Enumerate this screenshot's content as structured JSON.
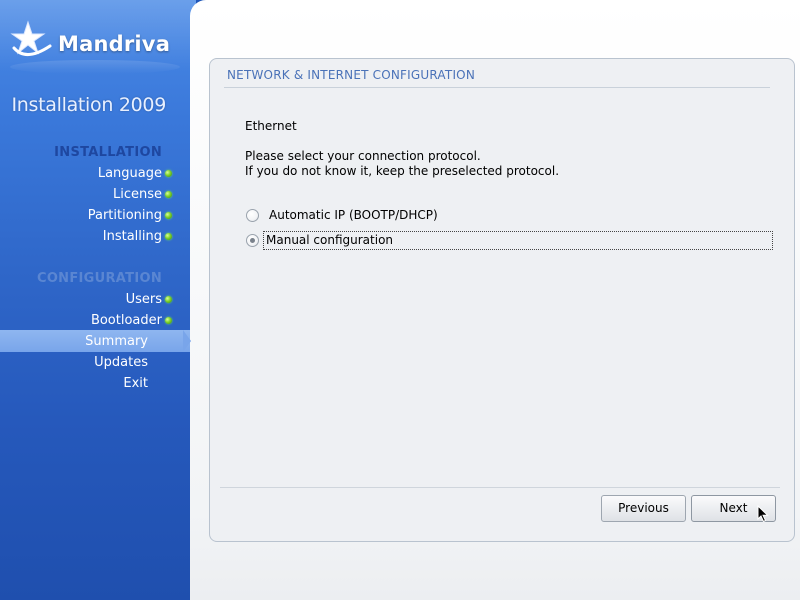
{
  "brand": {
    "name": "Mandriva",
    "product": "Installation 2009"
  },
  "sidebar": {
    "installation_title": "INSTALLATION",
    "installation_steps": [
      "Language",
      "License",
      "Partitioning",
      "Installing"
    ],
    "configuration_title": "CONFIGURATION",
    "configuration_steps": [
      "Users",
      "Bootloader"
    ],
    "current_step": "Summary",
    "other_steps": [
      "Updates",
      "Exit"
    ]
  },
  "panel": {
    "title": "NETWORK & INTERNET CONFIGURATION",
    "subtitle": "Ethernet",
    "prompt_line1": "Please select your connection protocol.",
    "prompt_line2": "If you do not know it, keep the preselected protocol.",
    "options": [
      {
        "label": "Automatic IP (BOOTP/DHCP)",
        "selected": false
      },
      {
        "label": "Manual configuration",
        "selected": true
      }
    ]
  },
  "buttons": {
    "previous": "Previous",
    "next": "Next"
  },
  "colors": {
    "sidebar": "#2f67c9",
    "section_title": "#1e47a0",
    "panel_title": "#4a72b8",
    "status_dot": "#7fd02a"
  }
}
